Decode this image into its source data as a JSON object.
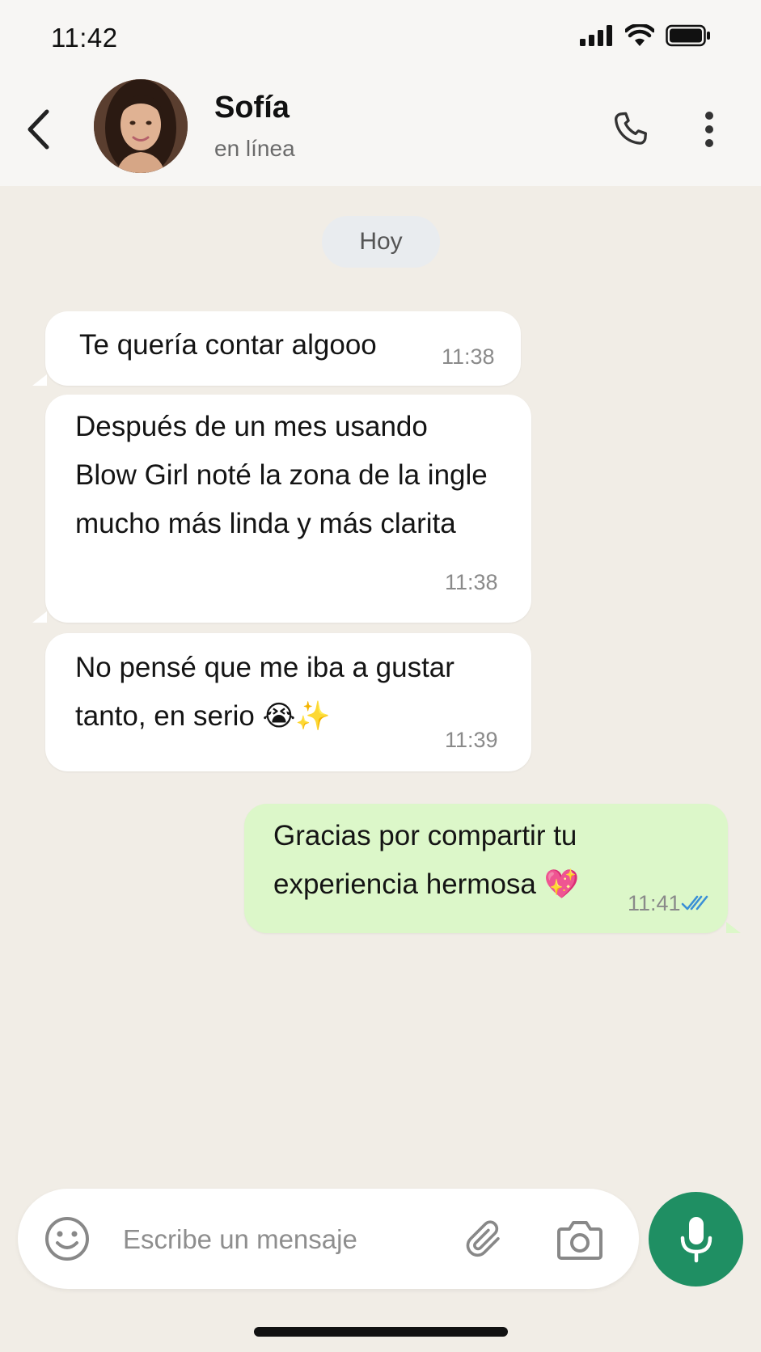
{
  "status_bar": {
    "time": "11:42"
  },
  "header": {
    "name": "Sofía",
    "status": "en línea"
  },
  "chat": {
    "date_chip": "Hoy",
    "messages": [
      {
        "direction": "in",
        "text": "Te quería contar algooo",
        "time": "11:38"
      },
      {
        "direction": "in",
        "text": "Después de un mes usando Blow Girl noté la zona de la ingle mucho más linda y más clarita",
        "time": "11:38"
      },
      {
        "direction": "in",
        "text": "No pensé que me iba a gustar tanto, en serio 😭✨",
        "time": "11:39"
      },
      {
        "direction": "out",
        "text": "Gracias por compartir tu experiencia hermosa 💖",
        "time": "11:41",
        "read": true
      }
    ]
  },
  "composer": {
    "placeholder": "Escribe un mensaje"
  },
  "colors": {
    "chat_background": "#f1ede6",
    "incoming_bubble": "#ffffff",
    "outgoing_bubble": "#dcf7c9",
    "mic_button": "#1f8f63",
    "read_ticks": "#3a8fd6"
  },
  "icons": [
    "back-arrow-icon",
    "phone-icon",
    "more-vertical-icon",
    "emoji-icon",
    "paperclip-icon",
    "camera-icon",
    "microphone-icon",
    "double-check-icon",
    "signal-icon",
    "wifi-icon",
    "battery-icon"
  ]
}
